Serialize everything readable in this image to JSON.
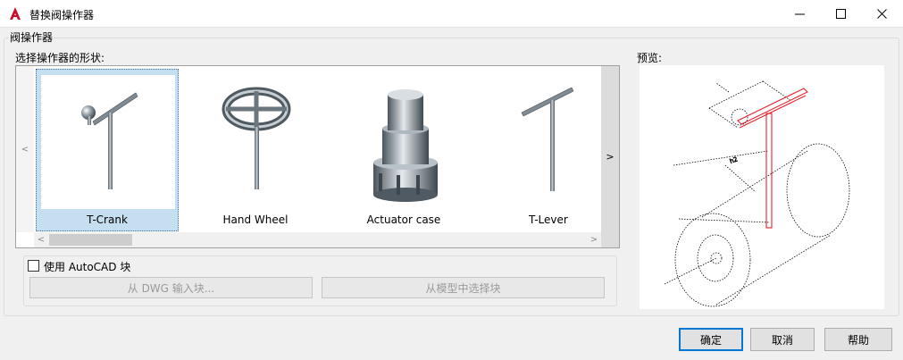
{
  "window": {
    "title": "替换阀操作器"
  },
  "group": {
    "title": "阀操作器"
  },
  "gallery": {
    "label": "选择操作器的形状:",
    "nav_left": "<",
    "nav_right": ">",
    "items": [
      {
        "label": "T-Crank",
        "icon": "t-crank-icon",
        "selected": true
      },
      {
        "label": "Hand Wheel",
        "icon": "hand-wheel-icon",
        "selected": false
      },
      {
        "label": "Actuator case",
        "icon": "actuator-case-icon",
        "selected": false
      },
      {
        "label": "T-Lever",
        "icon": "t-lever-icon",
        "selected": false
      }
    ],
    "scroll_left": "<",
    "scroll_right": ">"
  },
  "autocad": {
    "checkbox_label": "使用 AutoCAD 块",
    "checked": false,
    "from_dwg": "从 DWG 输入块...",
    "from_model": "从模型中选择块"
  },
  "preview": {
    "label": "预览:"
  },
  "buttons": {
    "ok": "确定",
    "cancel": "取消",
    "help": "帮助"
  },
  "colors": {
    "accent": "#0078d7",
    "selection": "#c5def0",
    "brand": "#c8102e",
    "preview_highlight": "#e8202a"
  }
}
